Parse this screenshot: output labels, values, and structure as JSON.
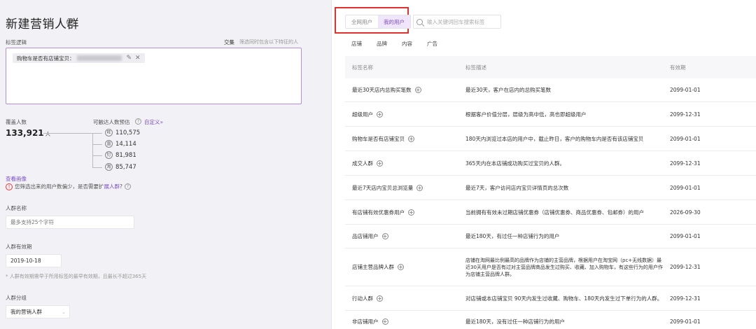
{
  "left": {
    "title": "新建营销人群",
    "info_icon": "info-icon",
    "logic_label": "标签逻辑",
    "intersect_label": "交集",
    "intersect_hint": "筛选同时包含以下特征的人",
    "tag_chip": "购物车是否有店铺宝贝：",
    "cover_label": "覆盖人数",
    "cover_value": "133,921",
    "cover_unit": "人",
    "reach_label": "可触达人数预估",
    "reach_custom": "自定义»",
    "channels": [
      {
        "icon": "旺",
        "value": "110,575"
      },
      {
        "icon": "直",
        "value": "14,114"
      },
      {
        "icon": "钉",
        "value": "81,981"
      },
      {
        "icon": "淘",
        "value": "85,747"
      }
    ],
    "portrait_link": "查看画像",
    "warn_text": "您筛选出来的用户数偏少，是否需要扩",
    "warn_link": "展人群",
    "warn_q": "?",
    "name_label": "人群名称",
    "name_placeholder": "最多支持25个字符",
    "validity_label": "人群有效期",
    "validity_value": "2019-10-18",
    "validity_hint": "* 人群有效期需早于所用标签的最早有效期，且最长不超过365天",
    "group_label": "人群分组",
    "group_value": "我的营销人群"
  },
  "right": {
    "seg": [
      "全网用户",
      "我的用户"
    ],
    "search_placeholder": "输入关键词回车搜索标签",
    "cats": [
      "店铺",
      "品牌",
      "内容",
      "广告"
    ],
    "headers": [
      "标签名称",
      "标签描述",
      "有效期"
    ],
    "rows": [
      {
        "name": "最近30天店内总购买笔数",
        "desc": "最近30天，客户在店内的总购买笔数",
        "date": "2099-01-01"
      },
      {
        "name": "超级用户",
        "desc": "根据客户价值分层，层级为高中低，高也即超级用户",
        "date": "2099-12-31"
      },
      {
        "name": "购物车是否有店铺宝贝",
        "desc": "180天内浏览过本店的用户中，截止昨日，客户的购物车内是否有该店铺宝贝",
        "date": "2099-01-01"
      },
      {
        "name": "成交人群",
        "desc": "365天内在本店铺成功购买过宝贝的人群。",
        "date": "2099-12-31"
      },
      {
        "name": "最近7天店内宝贝总浏览量",
        "desc": "最近7天，客户访问店内宝贝详情页的总次数",
        "date": "2099-01-01"
      },
      {
        "name": "有店铺有效优惠券用户",
        "desc": "当前拥有有效未过期店铺优惠券（店铺优惠券、商品优惠券、包邮券）的用户",
        "date": "2026-09-30"
      },
      {
        "name": "品店铺用户",
        "desc": "最近180天，有过任一种店铺行为的用户",
        "date": "2099-01-01"
      },
      {
        "name": "店铺主营品牌人群",
        "desc": "店铺在淘网最比例最高的品牌作为店铺的主营品牌，根据用户在淘宝网（pc+无线数据）最近30天用户是否有过对主营品牌商品发生过购买、收藏、加入购物车，有这些行为的用户作为店铺主营品牌人群。",
        "date": "2099-12-31"
      },
      {
        "name": "行动人群",
        "desc": "对店铺或本店铺宝贝 90天内发生过收藏、购物车、180天内发生过下单行为的人群。",
        "date": "2099-12-31"
      },
      {
        "name": "非店铺用户",
        "desc": "最近180天，没有过任一种店铺行为的用户",
        "date": "2099-01-01"
      }
    ]
  }
}
